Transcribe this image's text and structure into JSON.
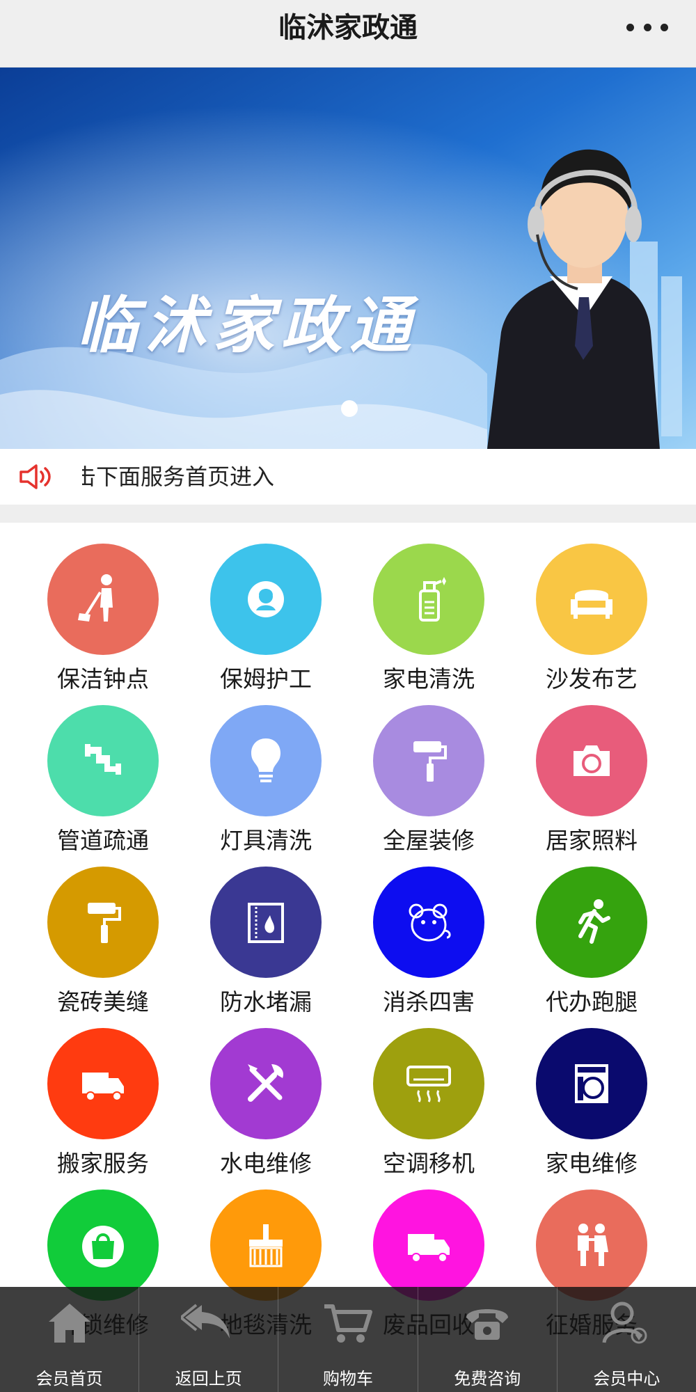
{
  "header": {
    "title": "临沭家政通",
    "more_icon": "more-dots-icon"
  },
  "banner": {
    "title": "临沭家政通",
    "slide_indicator": "carousel-dot"
  },
  "notice": {
    "icon": "speaker-icon",
    "text": "击下面服务首页进入"
  },
  "services": [
    {
      "label": "保洁钟点",
      "color": "#E96C5C",
      "icon": "cleaner-icon"
    },
    {
      "label": "保姆护工",
      "color": "#3DC3EB",
      "icon": "nanny-icon"
    },
    {
      "label": "家电清洗",
      "color": "#9BD84C",
      "icon": "spray-bottle-icon"
    },
    {
      "label": "沙发布艺",
      "color": "#F9C644",
      "icon": "sofa-icon"
    },
    {
      "label": "管道疏通",
      "color": "#4DDDAB",
      "icon": "pipe-icon"
    },
    {
      "label": "灯具清洗",
      "color": "#7FA8F5",
      "icon": "light-bulb-icon"
    },
    {
      "label": "全屋装修",
      "color": "#A88BE0",
      "icon": "paint-roller-icon"
    },
    {
      "label": "居家照料",
      "color": "#E85C7B",
      "icon": "camera-icon"
    },
    {
      "label": "瓷砖美缝",
      "color": "#D59A00",
      "icon": "paint-roller-icon"
    },
    {
      "label": "防水堵漏",
      "color": "#3A3893",
      "icon": "water-drop-icon"
    },
    {
      "label": "消杀四害",
      "color": "#0D0DF0",
      "icon": "mouse-icon"
    },
    {
      "label": "代办跑腿",
      "color": "#35A30E",
      "icon": "runner-icon"
    },
    {
      "label": "搬家服务",
      "color": "#FF3B10",
      "icon": "truck-icon"
    },
    {
      "label": "水电维修",
      "color": "#A23AD2",
      "icon": "tools-icon"
    },
    {
      "label": "空调移机",
      "color": "#9EA00E",
      "icon": "air-conditioner-icon"
    },
    {
      "label": "家电维修",
      "color": "#0A0A6E",
      "icon": "washing-machine-icon"
    },
    {
      "label": "开锁维修",
      "color": "#11CC3A",
      "icon": "bag-icon"
    },
    {
      "label": "地毯清洗",
      "color": "#FF9A0A",
      "icon": "broom-icon"
    },
    {
      "label": "废品回收",
      "color": "#FF14E0",
      "icon": "truck-icon"
    },
    {
      "label": "征婚服务",
      "color": "#E96C5C",
      "icon": "couple-icon"
    }
  ],
  "tabbar": [
    {
      "label": "会员首页",
      "icon": "home-icon"
    },
    {
      "label": "返回上页",
      "icon": "back-icon"
    },
    {
      "label": "购物车",
      "icon": "cart-icon"
    },
    {
      "label": "免费咨询",
      "icon": "phone-icon"
    },
    {
      "label": "会员中心",
      "icon": "user-icon"
    }
  ]
}
